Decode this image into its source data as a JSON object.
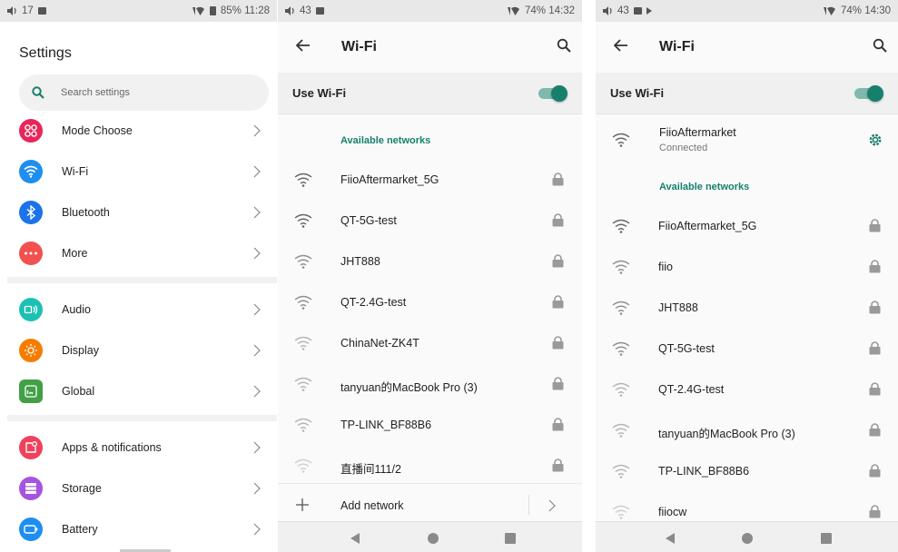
{
  "panel1": {
    "status": {
      "left": "17",
      "right": "85% 11:28"
    },
    "title": "Settings",
    "search": {
      "placeholder": "Search settings"
    },
    "items": [
      {
        "label": "Mode Choose",
        "icon": "mode-choose-icon",
        "color": "#e8265a"
      },
      {
        "label": "Wi-Fi",
        "icon": "wifi-icon",
        "color": "#1e8ef0"
      },
      {
        "label": "Bluetooth",
        "icon": "bluetooth-icon",
        "color": "#1a73e8"
      },
      {
        "label": "More",
        "icon": "more-dots-icon",
        "color": "#f2514f"
      },
      {
        "label": "Audio",
        "icon": "audio-icon",
        "color": "#1cc1b4"
      },
      {
        "label": "Display",
        "icon": "display-sun-icon",
        "color": "#f57c00"
      },
      {
        "label": "Global",
        "icon": "global-icon",
        "color": "#43a047"
      },
      {
        "label": "Apps & notifications",
        "icon": "apps-notifications-icon",
        "color": "#f0405a"
      },
      {
        "label": "Storage",
        "icon": "storage-icon",
        "color": "#a653e0"
      },
      {
        "label": "Battery",
        "icon": "battery-icon",
        "color": "#1e8ef0"
      }
    ]
  },
  "panel2": {
    "status": {
      "left": "43",
      "right": "74% 14:32"
    },
    "title": "Wi-Fi",
    "use_wifi": "Use Wi-Fi",
    "available": "Available networks",
    "networks": [
      "FiioAftermarket_5G",
      "QT-5G-test",
      "JHT888",
      "QT-2.4G-test",
      "ChinaNet-ZK4T",
      "tanyuan的MacBook Pro (3)",
      "TP-LINK_BF88B6",
      "直播间111/2"
    ],
    "add_network": "Add network"
  },
  "panel3": {
    "status": {
      "left": "43",
      "right": "74% 14:30"
    },
    "title": "Wi-Fi",
    "use_wifi": "Use Wi-Fi",
    "connected": {
      "name": "FiioAftermarket",
      "status": "Connected"
    },
    "available": "Available networks",
    "networks": [
      "FiioAftermarket_5G",
      "fiio",
      "JHT888",
      "QT-5G-test",
      "QT-2.4G-test",
      "tanyuan的MacBook Pro (3)",
      "TP-LINK_BF88B6",
      "fiiocw"
    ]
  },
  "colors": {
    "accent": "#17806d",
    "toggle_track": "#7fb9ad"
  }
}
